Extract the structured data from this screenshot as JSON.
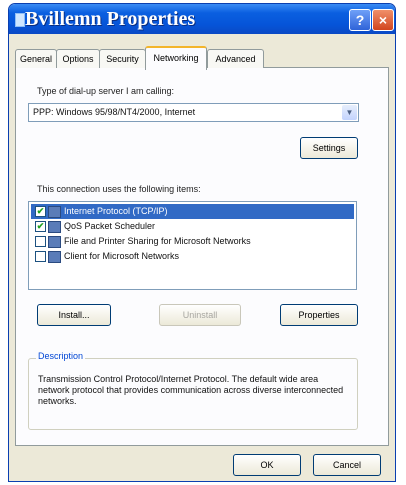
{
  "window": {
    "title": "Bvillemn Properties",
    "help_glyph": "?",
    "close_glyph": "×"
  },
  "tabs": [
    {
      "label": "General"
    },
    {
      "label": "Options"
    },
    {
      "label": "Security"
    },
    {
      "label": "Networking"
    },
    {
      "label": "Advanced"
    }
  ],
  "active_tab": "Networking",
  "server": {
    "label": "Type of dial-up server I am calling:",
    "value": "PPP: Windows 95/98/NT4/2000, Internet",
    "arrow": "▼",
    "settings_label": "Settings"
  },
  "items": {
    "label": "This connection uses the following items:",
    "list": [
      {
        "label": "Internet Protocol (TCP/IP)",
        "checked": true,
        "selected": true,
        "check": "✔"
      },
      {
        "label": "QoS Packet Scheduler",
        "checked": true,
        "selected": false,
        "check": "✔"
      },
      {
        "label": "File and Printer Sharing for Microsoft Networks",
        "checked": false,
        "selected": false,
        "check": ""
      },
      {
        "label": "Client for Microsoft Networks",
        "checked": false,
        "selected": false,
        "check": ""
      }
    ]
  },
  "buttons": {
    "install": "Install...",
    "uninstall": "Uninstall",
    "properties": "Properties",
    "ok": "OK",
    "cancel": "Cancel"
  },
  "description": {
    "label": "Description",
    "text": "Transmission Control Protocol/Internet Protocol. The default wide area network protocol that provides communication across diverse interconnected networks."
  }
}
